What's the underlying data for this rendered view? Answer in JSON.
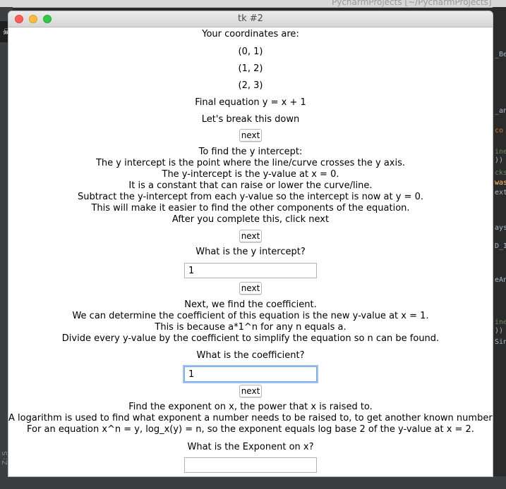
{
  "background": {
    "ide_title": "PycharmProjects [~/PycharmProjects]",
    "right_fragments": [
      "_Be",
      "_an",
      "co",
      "ine",
      "))",
      "cks",
      "was",
      "ext",
      "ays",
      "D_I",
      "eAns",
      "ine",
      "))",
      "Sinp"
    ],
    "left_label": "Z: S"
  },
  "window": {
    "title": "tk #2"
  },
  "content": {
    "heading": "Your coordinates are:",
    "coordinates": [
      "(0, 1)",
      "(1, 2)",
      "(2, 3)"
    ],
    "final_equation": "Final equation y = x + 1",
    "breakdown": "Let's break this down",
    "next_label": "next",
    "intercept_explanation": [
      "To find the y intercept:",
      "The y intercept is the point where the line/curve crosses the y axis.",
      "The y-intercept is the y-value at x = 0.",
      "It is a constant that can raise or lower the curve/line.",
      "Subtract the y-intercept from each y-value so the intercept is now at y = 0.",
      "This will make it easier to find the other components of the equation.",
      "After you complete this, click next"
    ],
    "intercept_question": "What is the y intercept?",
    "intercept_answer": "1",
    "coefficient_explanation": [
      "Next, we find the coefficient.",
      "We can determine the coefficient of this equation is the new y-value at x = 1.",
      "This is because a*1^n for any n equals a.",
      "Divide every y-value by the coefficient to simplify the equation so n can be found."
    ],
    "coefficient_question": "What is the coefficient?",
    "coefficient_answer": "1",
    "exponent_explanation": [
      "Find the exponent on x, the power that x is raised to.",
      "A logarithm is used to find what exponent a number needs to be raised to, to get another known number.",
      "For an equation x^n = y, log_x(y) = n, so the exponent equals log base 2 of the y-value at x = 2."
    ],
    "exponent_question": "What is the Exponent on x?",
    "exponent_answer": ""
  }
}
